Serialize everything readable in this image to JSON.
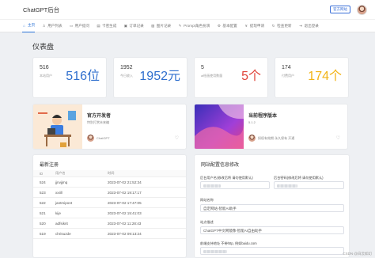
{
  "header": {
    "brand": "ChatGPT后台",
    "site_button": "官方网站"
  },
  "nav": [
    {
      "icon": "home-icon",
      "glyph": "⌂",
      "label": "主页",
      "active": true
    },
    {
      "icon": "user-icon",
      "glyph": "♙",
      "label": "用户列表"
    },
    {
      "icon": "chat-icon",
      "glyph": "▭",
      "label": "用户提问"
    },
    {
      "icon": "card-icon",
      "glyph": "▤",
      "label": "卡密生成"
    },
    {
      "icon": "order-icon",
      "glyph": "▣",
      "label": "订单记录"
    },
    {
      "icon": "image-icon",
      "glyph": "▨",
      "label": "图片记录"
    },
    {
      "icon": "prompt-icon",
      "glyph": "✎",
      "label": "Prompt角色扮演"
    },
    {
      "icon": "gear-icon",
      "glyph": "⚙",
      "label": "基本配置"
    },
    {
      "icon": "money-icon",
      "glyph": "¥",
      "label": "提现申请"
    },
    {
      "icon": "update-icon",
      "glyph": "↻",
      "label": "检查更新"
    },
    {
      "icon": "logout-icon",
      "glyph": "⇥",
      "label": "退出登录"
    }
  ],
  "page_title": "仪表盘",
  "stats": [
    {
      "number": "516",
      "label": "本站用户",
      "big": "516位",
      "color": "#2f6fce"
    },
    {
      "number": "1952",
      "label": "今日收入",
      "big": "1952元",
      "color": "#2f6fce"
    },
    {
      "number": "5",
      "label": "ai绘画使用数量",
      "big": "5个",
      "color": "#e0443a"
    },
    {
      "number": "174",
      "label": "付费用户",
      "big": "174个",
      "color": "#f2b316"
    }
  ],
  "cards": [
    {
      "title": "官方开发者",
      "subtitle": "特别打赏未来编",
      "user": "ChatGPT"
    },
    {
      "title": "当前程序版本",
      "subtitle": "5.1.2",
      "user": "授权有效期 永久保有 开通"
    }
  ],
  "recent": {
    "title": "最新注册",
    "headers": [
      "ID",
      "用户名",
      "时间"
    ],
    "rows": [
      [
        "524",
        "jjnvjjmq",
        "2023-07-02 21:52:34"
      ],
      [
        "523",
        "xxiill",
        "2023-07-02 19:17:17"
      ],
      [
        "522",
        "jantmipont",
        "2023-07-02 17:47:05"
      ],
      [
        "521",
        "kije",
        "2023-07-02 15:41:03"
      ],
      [
        "520",
        "adfsikrit",
        "2023-07-02 11:28:43"
      ],
      [
        "519",
        "chrisuzde",
        "2023-07-02 09:13:24"
      ]
    ]
  },
  "site_config": {
    "title": "网站配置信息修改",
    "label_1": "后台用户名(修改后将 请勿使用默认)",
    "label_2": "后台密码(修改后将 请勿使用默认)",
    "label_3": "网站名称",
    "value_3": "自定网站-智能AI助手",
    "label_4": "站点描述",
    "value_4": "ChatGPT中文网镜像-智能AI自由助手",
    "label_5": "前端支持地址 不带http, 例如baidu.com"
  },
  "watermark": "CSDN @白云如幻"
}
